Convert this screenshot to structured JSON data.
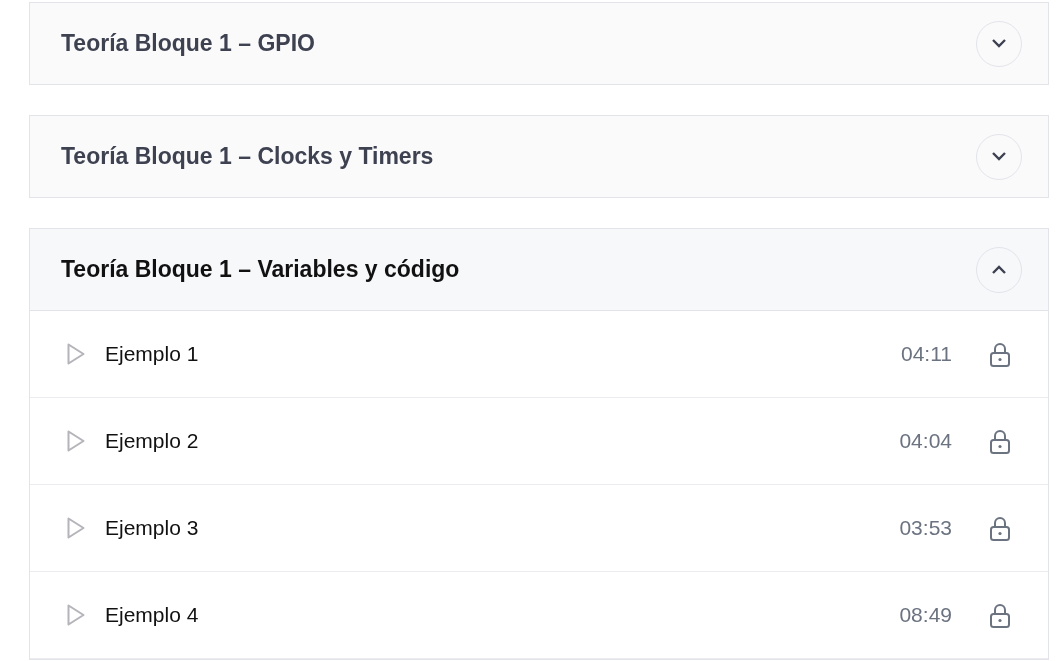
{
  "sections": [
    {
      "title": "Teoría Bloque 1 – GPIO",
      "expanded": false
    },
    {
      "title": "Teoría Bloque 1 – Clocks y Timers",
      "expanded": false
    },
    {
      "title": "Teoría Bloque 1 – Variables y código",
      "expanded": true,
      "lessons": [
        {
          "title": "Ejemplo 1",
          "duration": "04:11",
          "locked": true
        },
        {
          "title": "Ejemplo 2",
          "duration": "04:04",
          "locked": true
        },
        {
          "title": "Ejemplo 3",
          "duration": "03:53",
          "locked": true
        },
        {
          "title": "Ejemplo 4",
          "duration": "08:49",
          "locked": true
        }
      ]
    }
  ]
}
